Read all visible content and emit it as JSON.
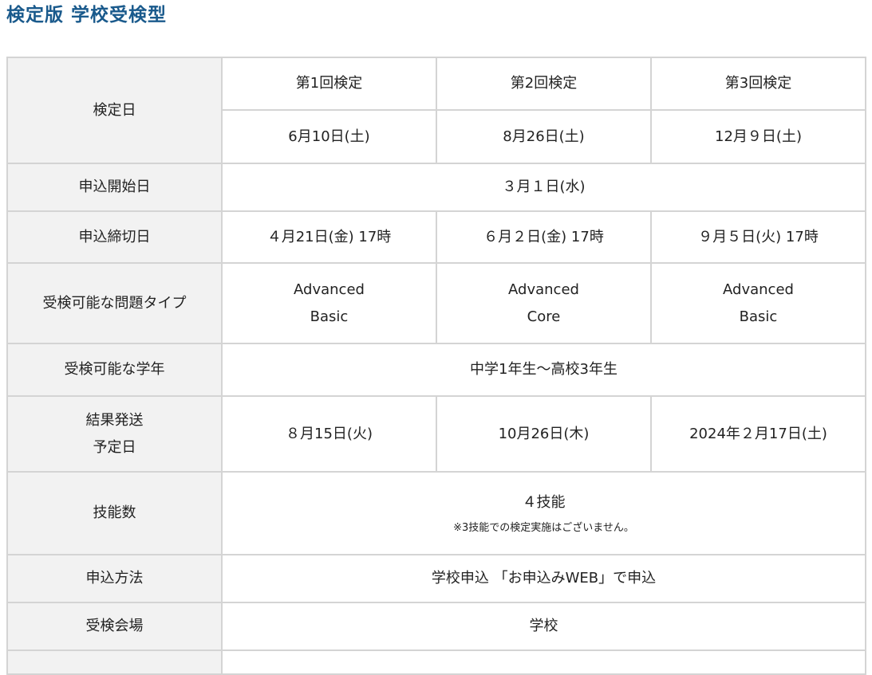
{
  "page": {
    "title": "検定版 学校受検型"
  },
  "table": {
    "exam_date_label": "検定日",
    "rounds": [
      "第1回検定",
      "第2回検定",
      "第3回検定"
    ],
    "exam_dates": [
      "6月10日(土)",
      "8月26日(土)",
      "12月９日(土)"
    ],
    "application_start_label": "申込開始日",
    "application_start": "３月１日(水)",
    "application_deadline_label": "申込締切日",
    "application_deadlines": [
      "４月21日(金) 17時",
      "６月２日(金) 17時",
      "９月５日(火) 17時"
    ],
    "problem_types_label": "受検可能な問題タイプ",
    "problem_types": [
      [
        "Advanced",
        "Basic"
      ],
      [
        "Advanced",
        "Core"
      ],
      [
        "Advanced",
        "Basic"
      ]
    ],
    "grades_label": "受検可能な学年",
    "grades": "中学1年生～高校3年生",
    "results_label_line1": "結果発送",
    "results_label_line2": "予定日",
    "results_dates": [
      "８月15日(火)",
      "10月26日(木)",
      "2024年２月17日(土)"
    ],
    "skills_label": "技能数",
    "skills_value": "４技能",
    "skills_note": "※3技能での検定実施はございません。",
    "method_label": "申込方法",
    "method_value": "学校申込 「お申込みWEB」で申込",
    "venue_label": "受検会場",
    "venue_value": "学校"
  }
}
